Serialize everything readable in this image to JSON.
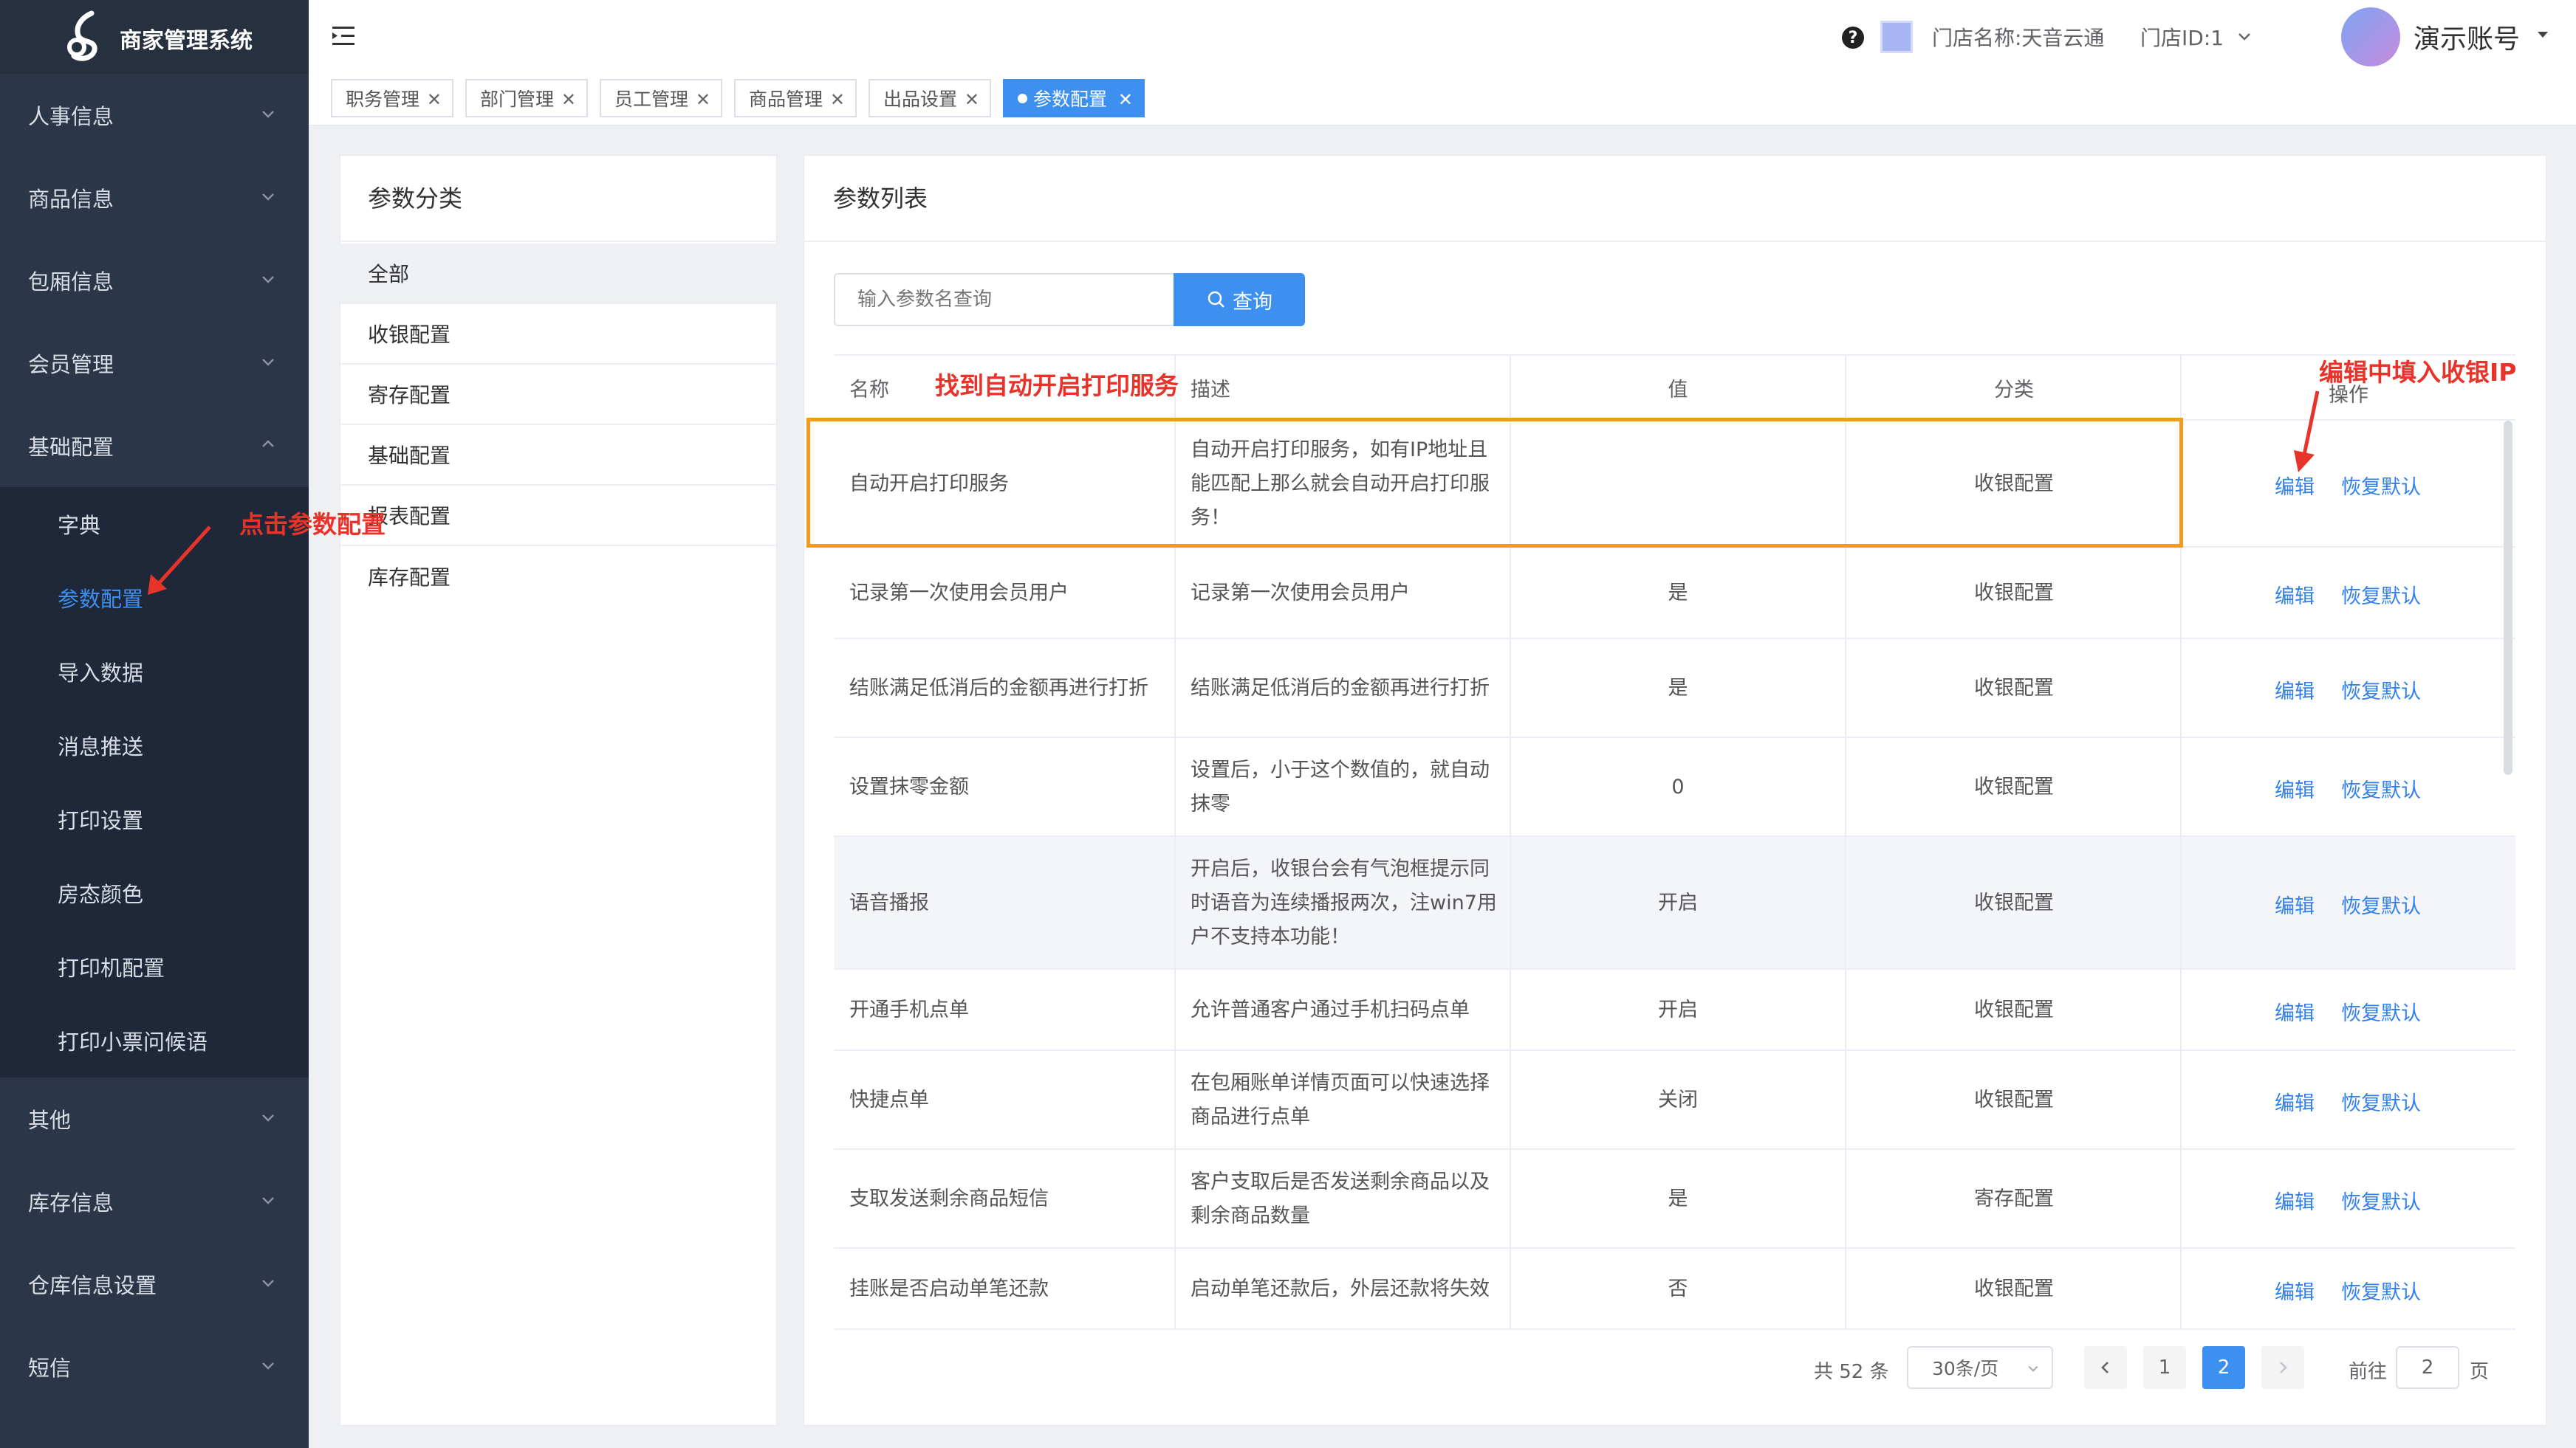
{
  "app": {
    "title": "商家管理系统"
  },
  "sidebar": {
    "menus": [
      {
        "label": "人事信息"
      },
      {
        "label": "商品信息"
      },
      {
        "label": "包厢信息"
      },
      {
        "label": "会员管理"
      },
      {
        "label": "基础配置"
      }
    ],
    "sub_items": [
      {
        "label": "字典"
      },
      {
        "label": "参数配置"
      },
      {
        "label": "导入数据"
      },
      {
        "label": "消息推送"
      },
      {
        "label": "打印设置"
      },
      {
        "label": "房态颜色"
      },
      {
        "label": "打印机配置"
      },
      {
        "label": "打印小票问候语"
      }
    ],
    "menus_after": [
      {
        "label": "其他"
      },
      {
        "label": "库存信息"
      },
      {
        "label": "仓库信息设置"
      },
      {
        "label": "短信"
      }
    ]
  },
  "header": {
    "store_name": "门店名称:天音云通",
    "store_id": "门店ID:1",
    "account": "演示账号"
  },
  "tabs": [
    {
      "label": "职务管理"
    },
    {
      "label": "部门管理"
    },
    {
      "label": "员工管理"
    },
    {
      "label": "商品管理"
    },
    {
      "label": "出品设置"
    },
    {
      "label": "参数配置"
    }
  ],
  "categories": {
    "title": "参数分类",
    "items": [
      "全部",
      "收银配置",
      "寄存配置",
      "基础配置",
      "报表配置",
      "库存配置"
    ]
  },
  "params": {
    "title": "参数列表",
    "search_placeholder": "输入参数名查询",
    "search_button": "查询",
    "columns": {
      "name": "名称",
      "desc": "描述",
      "value": "值",
      "category": "分类",
      "ops": "操作"
    },
    "edit_label": "编辑",
    "reset_label": "恢复默认",
    "rows": [
      {
        "name": "自动开启打印服务",
        "desc": "自动开启打印服务，如有IP地址且能匹配上那么就会自动开启打印服务！",
        "value": "",
        "category": "收银配置"
      },
      {
        "name": "记录第一次使用会员用户",
        "desc": "记录第一次使用会员用户",
        "value": "是",
        "category": "收银配置"
      },
      {
        "name": "结账满足低消后的金额再进行打折",
        "desc": "结账满足低消后的金额再进行打折",
        "value": "是",
        "category": "收银配置"
      },
      {
        "name": "设置抹零金额",
        "desc": "设置后，小于这个数值的，就自动抹零",
        "value": "0",
        "category": "收银配置"
      },
      {
        "name": "语音播报",
        "desc": "开启后，收银台会有气泡框提示同时语音为连续播报两次，注win7用户不支持本功能！",
        "value": "开启",
        "category": "收银配置"
      },
      {
        "name": "开通手机点单",
        "desc": "允许普通客户通过手机扫码点单",
        "value": "开启",
        "category": "收银配置"
      },
      {
        "name": "快捷点单",
        "desc": "在包厢账单详情页面可以快速选择商品进行点单",
        "value": "关闭",
        "category": "收银配置"
      },
      {
        "name": "支取发送剩余商品短信",
        "desc": "客户支取后是否发送剩余商品以及剩余商品数量",
        "value": "是",
        "category": "寄存配置"
      },
      {
        "name": "挂账是否启动单笔还款",
        "desc": "启动单笔还款后，外层还款将失效",
        "value": "否",
        "category": "收银配置"
      }
    ]
  },
  "pagination": {
    "total": "共 52 条",
    "page_size": "30条/页",
    "pages": [
      "1",
      "2"
    ],
    "goto_prefix": "前往",
    "goto_value": "2",
    "goto_suffix": "页"
  },
  "annotations": {
    "click_param": "点击参数配置",
    "find_service": "找到自动开启打印服务",
    "fill_ip": "编辑中填入收银IP"
  },
  "colors": {
    "sidebar": "#2b3649",
    "accent": "#3d8ff0",
    "highlight_box": "#f29b1d",
    "annotation": "#e8332a"
  }
}
